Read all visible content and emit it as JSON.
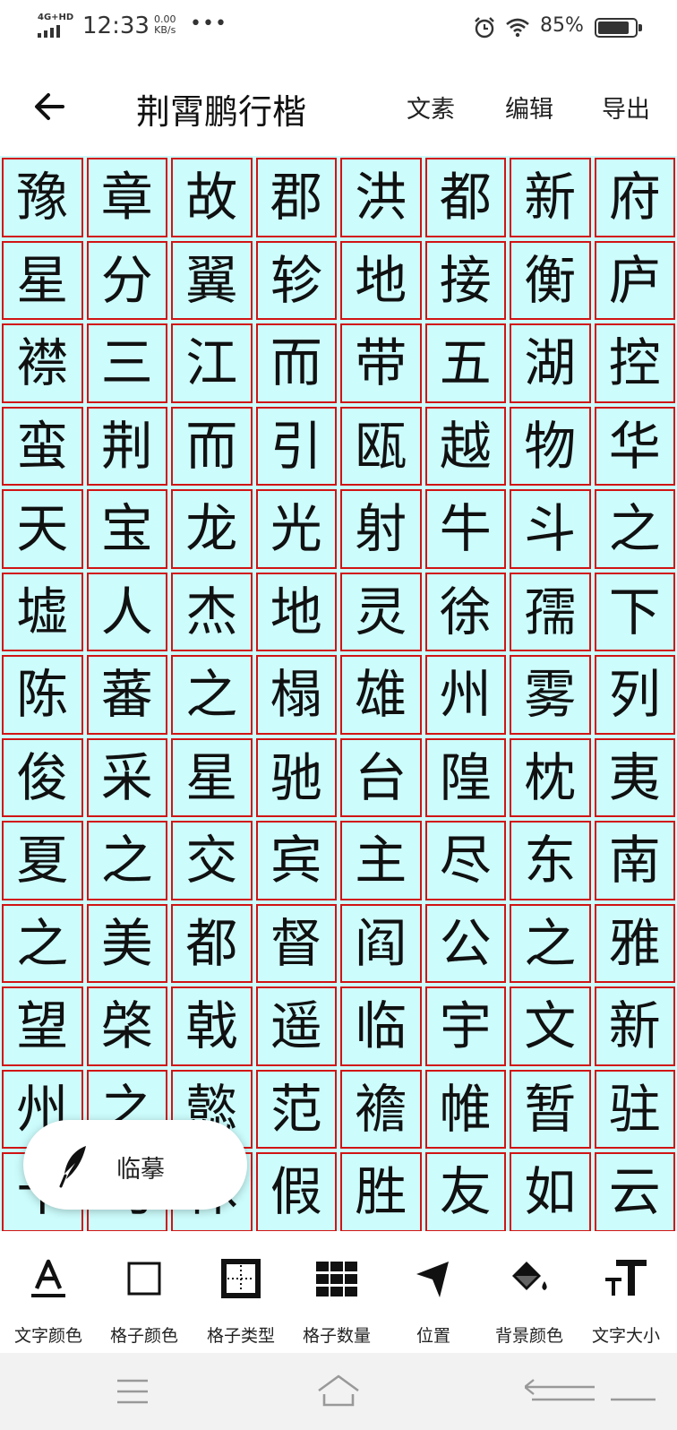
{
  "status_bar": {
    "network": "4G+HD",
    "time": "12:33",
    "speed_value": "0.00",
    "speed_unit": "KB/s",
    "more": "•••",
    "battery_percent": "85%",
    "battery_level": 0.85
  },
  "app_bar": {
    "title": "荆霄鹏行楷",
    "actions": [
      "文素",
      "编辑",
      "导出"
    ]
  },
  "grid": {
    "columns": 8,
    "cell_border_color": "#d11414",
    "cell_background": "#ccfcfc",
    "rows": [
      [
        "豫",
        "章",
        "故",
        "郡",
        "洪",
        "都",
        "新",
        "府"
      ],
      [
        "星",
        "分",
        "翼",
        "轸",
        "地",
        "接",
        "衡",
        "庐"
      ],
      [
        "襟",
        "三",
        "江",
        "而",
        "带",
        "五",
        "湖",
        "控"
      ],
      [
        "蛮",
        "荆",
        "而",
        "引",
        "瓯",
        "越",
        "物",
        "华"
      ],
      [
        "天",
        "宝",
        "龙",
        "光",
        "射",
        "牛",
        "斗",
        "之"
      ],
      [
        "墟",
        "人",
        "杰",
        "地",
        "灵",
        "徐",
        "孺",
        "下"
      ],
      [
        "陈",
        "蕃",
        "之",
        "榻",
        "雄",
        "州",
        "雾",
        "列"
      ],
      [
        "俊",
        "采",
        "星",
        "驰",
        "台",
        "隍",
        "枕",
        "夷"
      ],
      [
        "夏",
        "之",
        "交",
        "宾",
        "主",
        "尽",
        "东",
        "南"
      ],
      [
        "之",
        "美",
        "都",
        "督",
        "阎",
        "公",
        "之",
        "雅"
      ],
      [
        "望",
        "棨",
        "戟",
        "遥",
        "临",
        "宇",
        "文",
        "新"
      ],
      [
        "州",
        "之",
        "懿",
        "范",
        "襜",
        "帷",
        "暂",
        "驻"
      ],
      [
        "十",
        "旬",
        "休",
        "假",
        "胜",
        "友",
        "如",
        "云"
      ]
    ]
  },
  "copy_button": {
    "label": "临摹",
    "icon": "quill-icon"
  },
  "toolbar": {
    "items": [
      {
        "label": "文字颜色",
        "icon": "text-color-icon"
      },
      {
        "label": "格子颜色",
        "icon": "grid-color-icon"
      },
      {
        "label": "格子类型",
        "icon": "grid-type-icon"
      },
      {
        "label": "格子数量",
        "icon": "grid-count-icon"
      },
      {
        "label": "位置",
        "icon": "position-arrow-icon"
      },
      {
        "label": "背景颜色",
        "icon": "paint-bucket-icon"
      },
      {
        "label": "文字大小",
        "icon": "font-size-icon"
      }
    ]
  },
  "nav_bar": {
    "icons": [
      "menu-icon",
      "home-icon",
      "back-gesture-icon"
    ]
  }
}
